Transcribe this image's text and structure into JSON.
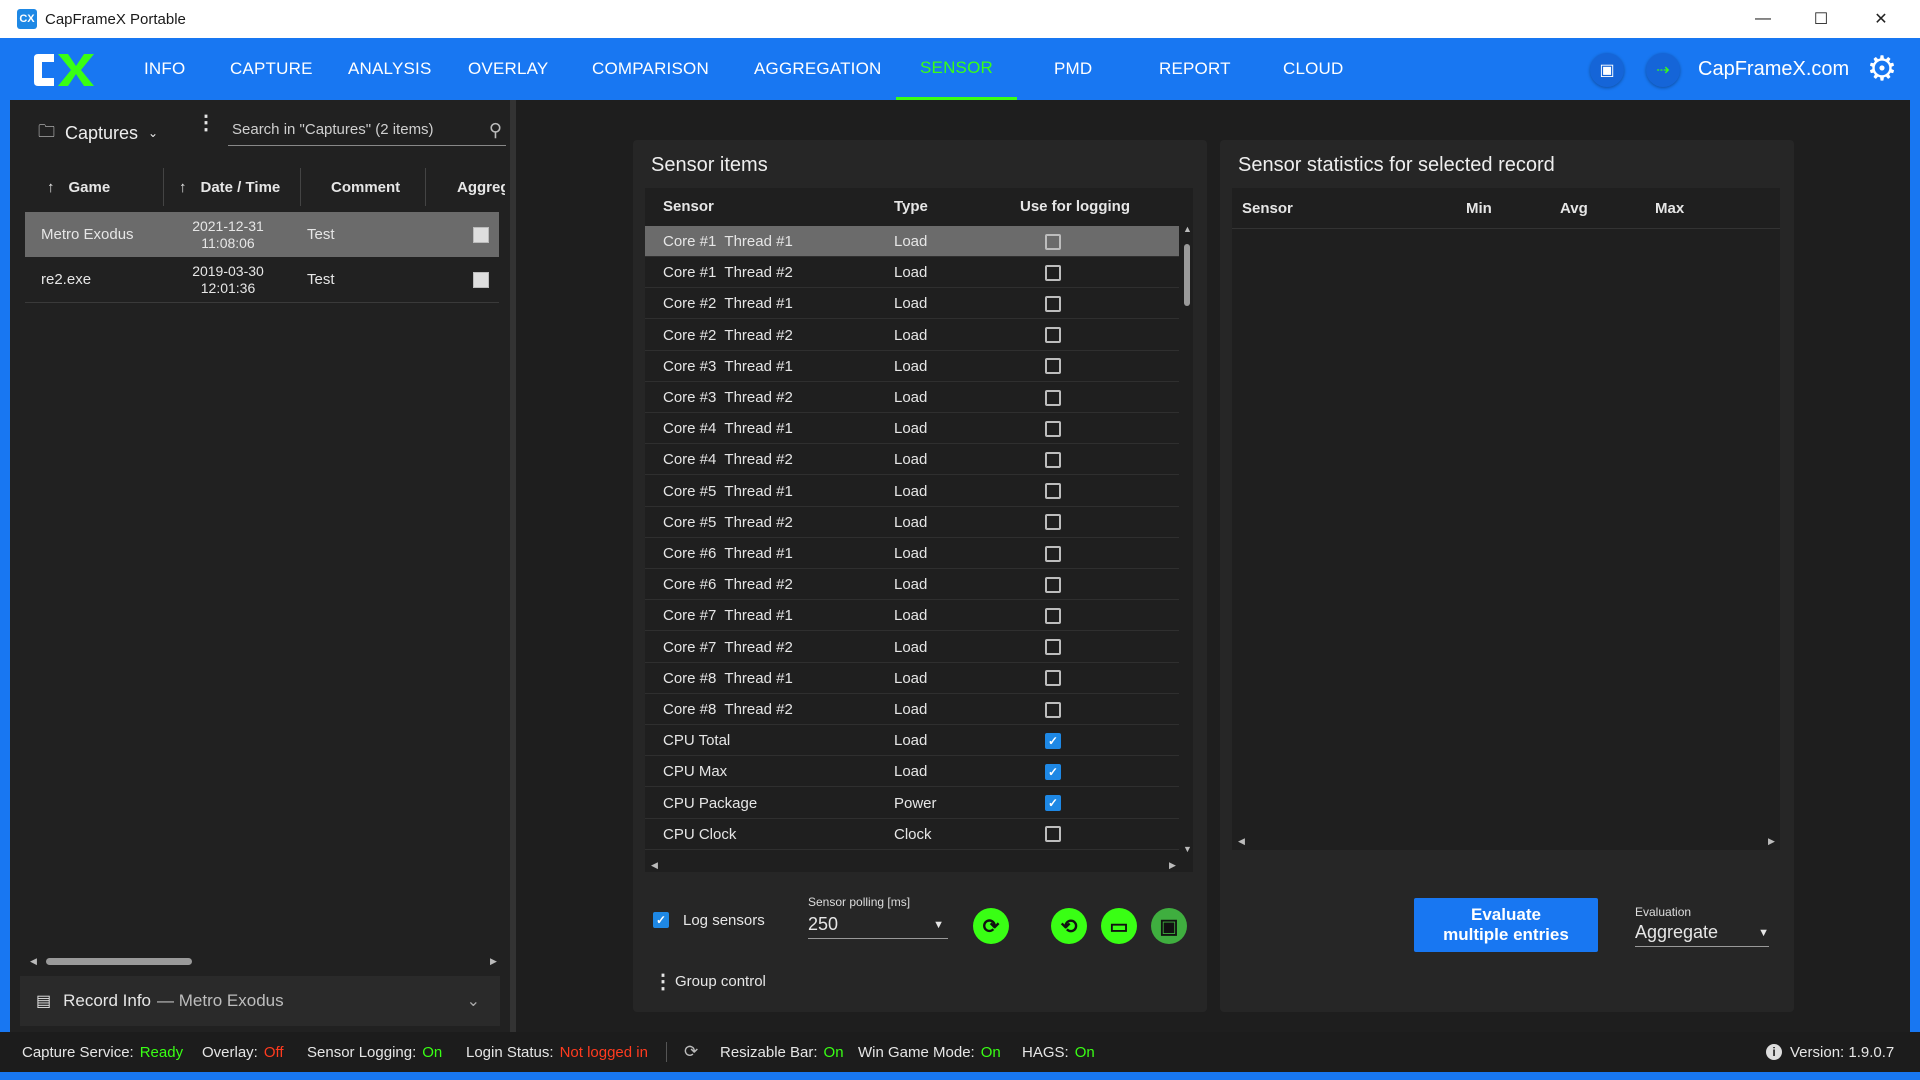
{
  "window": {
    "title": "CapFrameX Portable",
    "icon_text": "CX"
  },
  "nav": {
    "items": [
      "INFO",
      "CAPTURE",
      "ANALYSIS",
      "OVERLAY",
      "COMPARISON",
      "AGGREGATION",
      "SENSOR",
      "PMD",
      "REPORT",
      "CLOUD"
    ],
    "active": "SENSOR",
    "site": "CapFrameX.com"
  },
  "captures": {
    "folder_label": "Captures",
    "search_placeholder": "Search in \"Captures\" (2 items)",
    "columns": [
      "Game",
      "Date / Time",
      "Comment",
      "Aggrega"
    ],
    "rows": [
      {
        "game": "Metro Exodus",
        "date": "2021-12-31",
        "time": "11:08:06",
        "comment": "Test",
        "selected": true
      },
      {
        "game": "re2.exe",
        "date": "2019-03-30",
        "time": "12:01:36",
        "comment": "Test",
        "selected": false
      }
    ],
    "record_info_label": "Record Info",
    "record_info_game": "— Metro Exodus"
  },
  "sensor_items": {
    "title": "Sensor items",
    "columns": [
      "Sensor",
      "Type",
      "Use for logging"
    ],
    "rows": [
      {
        "sensor": "Core #1  Thread #1",
        "type": "Load",
        "checked": false
      },
      {
        "sensor": "Core #1  Thread #2",
        "type": "Load",
        "checked": false
      },
      {
        "sensor": "Core #2  Thread #1",
        "type": "Load",
        "checked": false
      },
      {
        "sensor": "Core #2  Thread #2",
        "type": "Load",
        "checked": false
      },
      {
        "sensor": "Core #3  Thread #1",
        "type": "Load",
        "checked": false
      },
      {
        "sensor": "Core #3  Thread #2",
        "type": "Load",
        "checked": false
      },
      {
        "sensor": "Core #4  Thread #1",
        "type": "Load",
        "checked": false
      },
      {
        "sensor": "Core #4  Thread #2",
        "type": "Load",
        "checked": false
      },
      {
        "sensor": "Core #5  Thread #1",
        "type": "Load",
        "checked": false
      },
      {
        "sensor": "Core #5  Thread #2",
        "type": "Load",
        "checked": false
      },
      {
        "sensor": "Core #6  Thread #1",
        "type": "Load",
        "checked": false
      },
      {
        "sensor": "Core #6  Thread #2",
        "type": "Load",
        "checked": false
      },
      {
        "sensor": "Core #7  Thread #1",
        "type": "Load",
        "checked": false
      },
      {
        "sensor": "Core #7  Thread #2",
        "type": "Load",
        "checked": false
      },
      {
        "sensor": "Core #8  Thread #1",
        "type": "Load",
        "checked": false
      },
      {
        "sensor": "Core #8  Thread #2",
        "type": "Load",
        "checked": false
      },
      {
        "sensor": "CPU Total",
        "type": "Load",
        "checked": true
      },
      {
        "sensor": "CPU Max",
        "type": "Load",
        "checked": true
      },
      {
        "sensor": "CPU Package",
        "type": "Power",
        "checked": true
      },
      {
        "sensor": "CPU Clock",
        "type": "Clock",
        "checked": false
      }
    ],
    "log_sensors_label": "Log sensors",
    "log_sensors_checked": true,
    "polling_label": "Sensor polling [ms]",
    "polling_value": "250",
    "group_control_label": "Group control"
  },
  "stats": {
    "title": "Sensor statistics for selected record",
    "columns": [
      "Sensor",
      "Min",
      "Avg",
      "Max"
    ],
    "evaluate_line1": "Evaluate",
    "evaluate_line2": "multiple entries",
    "evaluation_label": "Evaluation",
    "evaluation_value": "Aggregate"
  },
  "status": {
    "capture_service_label": "Capture Service:",
    "capture_service_value": "Ready",
    "overlay_label": "Overlay:",
    "overlay_value": "Off",
    "sensor_logging_label": "Sensor Logging:",
    "sensor_logging_value": "On",
    "login_label": "Login Status:",
    "login_value": "Not logged in",
    "rebar_label": "Resizable Bar:",
    "rebar_value": "On",
    "gamemode_label": "Win Game Mode:",
    "gamemode_value": "On",
    "hags_label": "HAGS:",
    "hags_value": "On",
    "version": "Version: 1.9.0.7"
  },
  "colors": {
    "accent_blue": "#1877f2",
    "accent_green": "#39ff14",
    "status_red": "#ff3b1f"
  },
  "icons": [
    "folder-icon",
    "chevron-down-icon",
    "kebab-menu-icon",
    "search-icon",
    "sort-arrow-icon",
    "screenshot-icon",
    "login-icon",
    "gear-icon",
    "refresh-icon",
    "reset-icon",
    "folder-open-icon",
    "save-icon",
    "info-icon",
    "history-icon"
  ]
}
